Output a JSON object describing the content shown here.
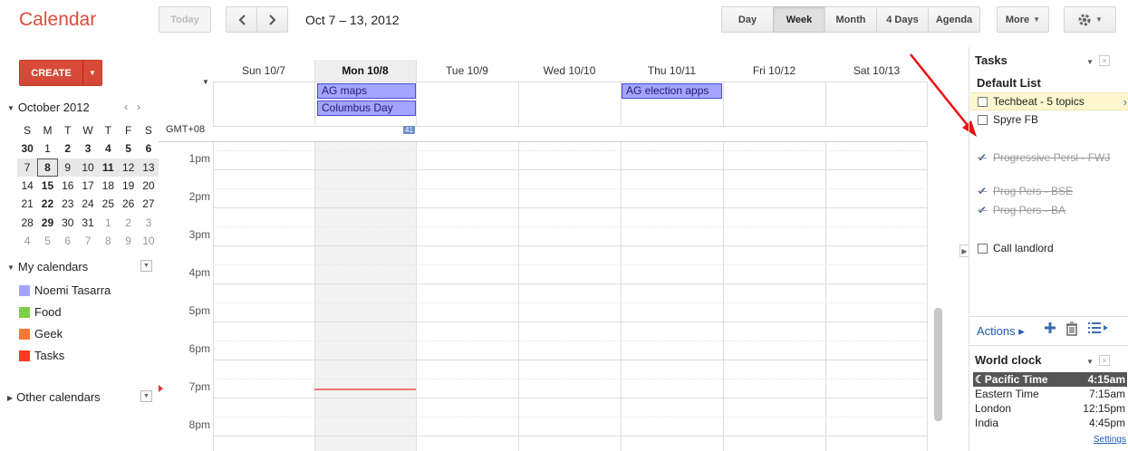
{
  "app": {
    "title": "Calendar"
  },
  "toolbar": {
    "today_label": "Today",
    "prev_label": "‹",
    "next_label": "›",
    "date_range": "Oct 7 – 13, 2012",
    "views": [
      "Day",
      "Week",
      "Month",
      "4 Days",
      "Agenda"
    ],
    "active_view": "Week",
    "more_label": "More",
    "settings_icon": "gear-icon"
  },
  "sidebar": {
    "create_label": "CREATE",
    "mini_month": "October 2012",
    "weekday_initials": [
      "S",
      "M",
      "T",
      "W",
      "T",
      "F",
      "S"
    ],
    "weeks": [
      [
        "30",
        "1",
        "2",
        "3",
        "4",
        "5",
        "6"
      ],
      [
        "7",
        "8",
        "9",
        "10",
        "11",
        "12",
        "13"
      ],
      [
        "14",
        "15",
        "16",
        "17",
        "18",
        "19",
        "20"
      ],
      [
        "21",
        "22",
        "23",
        "24",
        "25",
        "26",
        "27"
      ],
      [
        "28",
        "29",
        "30",
        "31",
        "1",
        "2",
        "3"
      ],
      [
        "4",
        "5",
        "6",
        "7",
        "8",
        "9",
        "10"
      ]
    ],
    "my_calendars_label": "My calendars",
    "calendars": [
      {
        "name": "Noemi Tasarra",
        "color": "#a4a4ff"
      },
      {
        "name": "Food",
        "color": "#7bd148"
      },
      {
        "name": "Geek",
        "color": "#ff7537"
      },
      {
        "name": "Tasks",
        "color": "#f83a22"
      }
    ],
    "other_calendars_label": "Other calendars"
  },
  "week": {
    "days": [
      "Sun 10/7",
      "Mon 10/8",
      "Tue 10/9",
      "Wed 10/10",
      "Thu 10/11",
      "Fri 10/12",
      "Sat 10/13"
    ],
    "today_index": 1,
    "timezone_label": "GMT+08",
    "more_badge": "41",
    "allday_events": [
      {
        "title": "AG maps",
        "day_index": 1,
        "row": 0
      },
      {
        "title": "Columbus Day",
        "day_index": 1,
        "row": 1
      },
      {
        "title": "AG election apps",
        "day_index": 4,
        "row": 0
      }
    ],
    "hours": [
      "1pm",
      "2pm",
      "3pm",
      "4pm",
      "5pm",
      "6pm",
      "7pm",
      "8pm"
    ],
    "event_color": "#a4a4ff"
  },
  "tasks": {
    "title": "Tasks",
    "list_name": "Default List",
    "items": [
      {
        "text": "Techbeat - 5 topics",
        "done": false,
        "selected": true
      },
      {
        "text": "Spyre FB",
        "done": false
      },
      {
        "text": "Progressive Persl - FWJ",
        "done": true
      },
      {
        "text": "Prog Pers - BSE",
        "done": true
      },
      {
        "text": "Prog Pers - BA",
        "done": true
      },
      {
        "text": "Call landlord",
        "done": false
      }
    ],
    "actions_label": "Actions ▸"
  },
  "world_clock": {
    "title": "World clock",
    "rows": [
      {
        "city": "Pacific Time",
        "time": "4:15am",
        "current": true
      },
      {
        "city": "Eastern Time",
        "time": "7:15am"
      },
      {
        "city": "London",
        "time": "12:15pm"
      },
      {
        "city": "India",
        "time": "4:45pm"
      }
    ],
    "settings_label": "Settings"
  }
}
